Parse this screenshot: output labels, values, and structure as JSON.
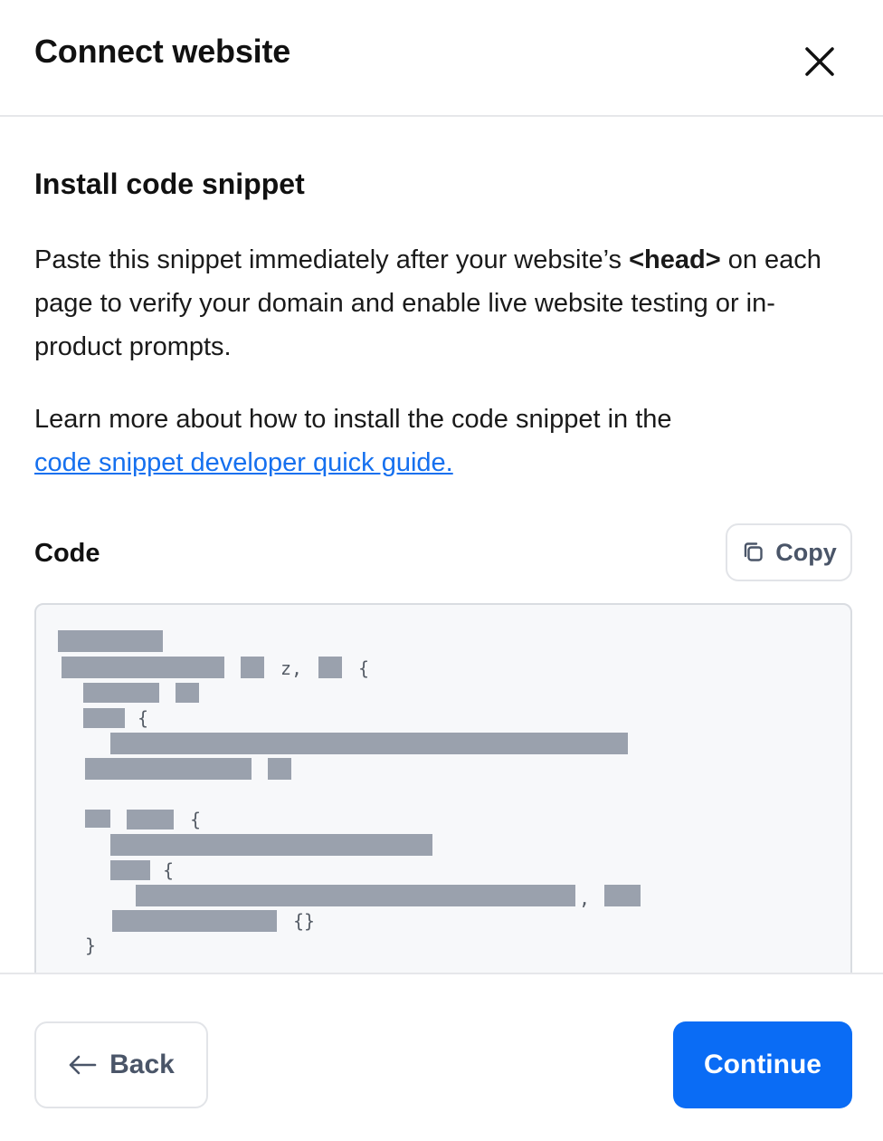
{
  "header": {
    "title": "Connect website"
  },
  "section": {
    "title": "Install code snippet",
    "desc_before": "Paste this snippet immediately after your website’s ",
    "desc_tag": "<head>",
    "desc_after": " on each page to verify your domain and enable live website testing or in-product prompts.",
    "learn_text": "Learn more about how to install the code snippet in the ",
    "learn_link": "code snippet developer quick guide."
  },
  "code": {
    "label": "Code",
    "copy_label": "Copy",
    "visible_chars": [
      "z,",
      "{",
      "{",
      "{",
      "{",
      ",",
      "{}",
      "}"
    ]
  },
  "footer": {
    "back_label": "Back",
    "continue_label": "Continue"
  },
  "colors": {
    "link": "#1570ef",
    "primary": "#0a6cf5",
    "redaction": "#9aa1ad"
  }
}
